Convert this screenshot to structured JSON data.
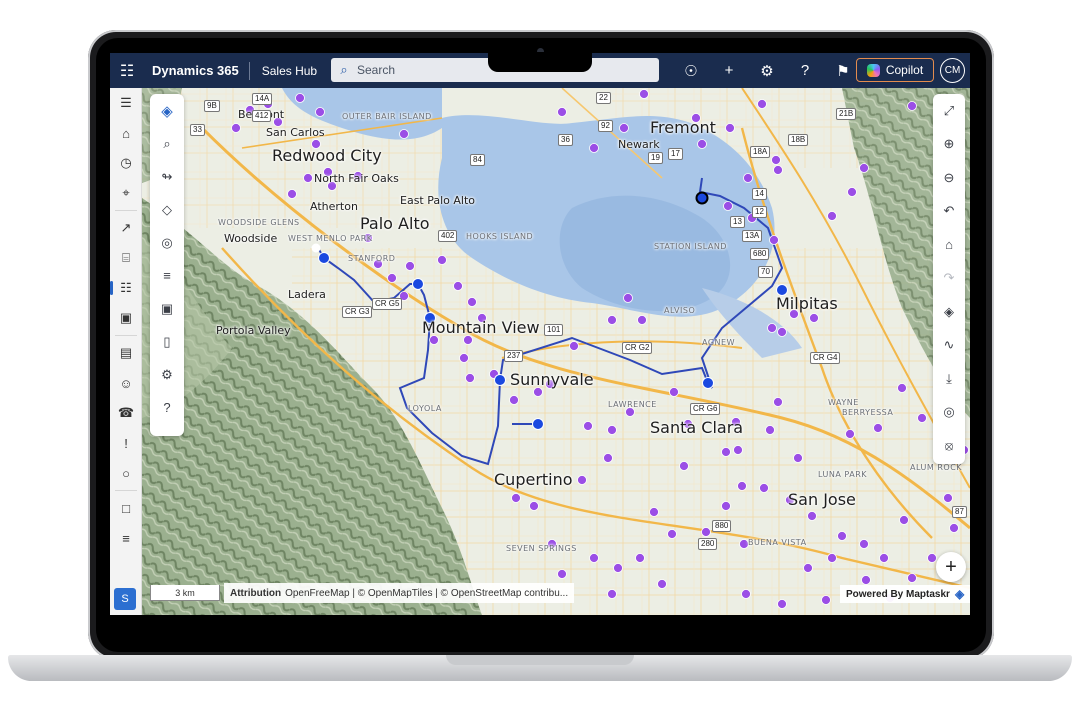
{
  "header": {
    "waffle_icon": "app-launcher-icon",
    "app_title": "Dynamics 365",
    "app_area": "Sales Hub",
    "search_placeholder": "Search",
    "icons": [
      "lightbulb-icon",
      "plus-icon",
      "settings-icon",
      "help-icon",
      "feedback-icon"
    ],
    "copilot_label": "Copilot",
    "avatar_initials": "CM"
  },
  "leftnav": {
    "items": [
      "menu-icon",
      "home-icon",
      "recent-icon",
      "pinned-icon",
      "rocket-icon",
      "clipboard-icon",
      "map-nav-icon",
      "box-icon",
      "book-icon",
      "contact-icon",
      "phone-icon",
      "alert-icon",
      "user-icon",
      "document-icon",
      "list-icon",
      "file-icon",
      "package-icon"
    ],
    "area_switch": "S"
  },
  "map": {
    "left_tools": [
      "layers-logo-icon",
      "search-icon",
      "route-icon",
      "layers-icon",
      "shapes-icon",
      "filter-icon",
      "camera-icon",
      "ruler-icon",
      "user-settings-icon",
      "question-icon"
    ],
    "right_tools": [
      "collapse-icon",
      "zoom-in-icon",
      "zoom-out-icon",
      "undo-icon",
      "home-icon",
      "redo-icon",
      "map-style-icon",
      "chart-icon",
      "download-icon",
      "pin-icon",
      "compass-icon"
    ],
    "fab_label": "+",
    "scale": "3 km",
    "attribution_title": "Attribution",
    "attribution_text": "OpenFreeMap | © OpenMapTiles | © OpenStreetMap contribu...",
    "powered_by": "Powered By Maptaskr",
    "cities_large": [
      "Redwood City",
      "Palo Alto",
      "Mountain View",
      "Sunnyvale",
      "Santa Clara",
      "Cupertino",
      "San Jose",
      "Fremont",
      "Milpitas"
    ],
    "cities_medium": [
      "Belmont",
      "San Carlos",
      "North Fair Oaks",
      "Atherton",
      "East Palo Alto",
      "Woodside",
      "Ladera",
      "Portola Valley",
      "Newark"
    ],
    "cities_small": [
      "OUTER BAIR ISLAND",
      "WOODSIDE GLENS",
      "WEST MENLO PARK",
      "STANFORD",
      "HOOKS ISLAND",
      "STATION ISLAND",
      "ALVISO",
      "AGNEW",
      "LAWRENCE",
      "LOYOLA",
      "SEVEN SPRINGS",
      "BUENA VISTA",
      "WAYNE",
      "BERRYESSA",
      "LUNA PARK",
      "ALUM ROCK"
    ],
    "shields": [
      "14A",
      "9B",
      "33",
      "412",
      "84",
      "402",
      "36",
      "92",
      "22",
      "12",
      "19",
      "17",
      "18B",
      "21B",
      "18A",
      "14",
      "13",
      "13A",
      "680",
      "70",
      "101",
      "237",
      "CR G5",
      "CR G3",
      "CR G2",
      "CR G4",
      "CR G6",
      "880",
      "280",
      "87"
    ],
    "colors": {
      "route": "#2f48b8",
      "stop": "#1b49e0",
      "poi": "#9b4ee6",
      "water": "#a9c6e8",
      "land": "#eceee4",
      "hills": "#8fa684"
    }
  }
}
